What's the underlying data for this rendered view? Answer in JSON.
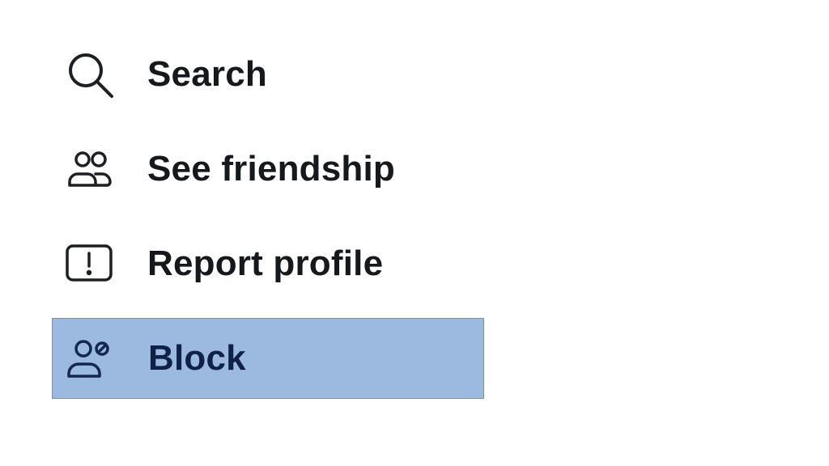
{
  "menu": {
    "items": [
      {
        "label": "Search",
        "icon": "search-icon",
        "highlighted": false
      },
      {
        "label": "See friendship",
        "icon": "people-icon",
        "highlighted": false
      },
      {
        "label": "Report profile",
        "icon": "report-icon",
        "highlighted": false
      },
      {
        "label": "Block",
        "icon": "block-user-icon",
        "highlighted": true
      }
    ]
  },
  "colors": {
    "highlight_background": "#9cb9df",
    "highlight_text": "#0f2146",
    "text": "#15181c"
  }
}
